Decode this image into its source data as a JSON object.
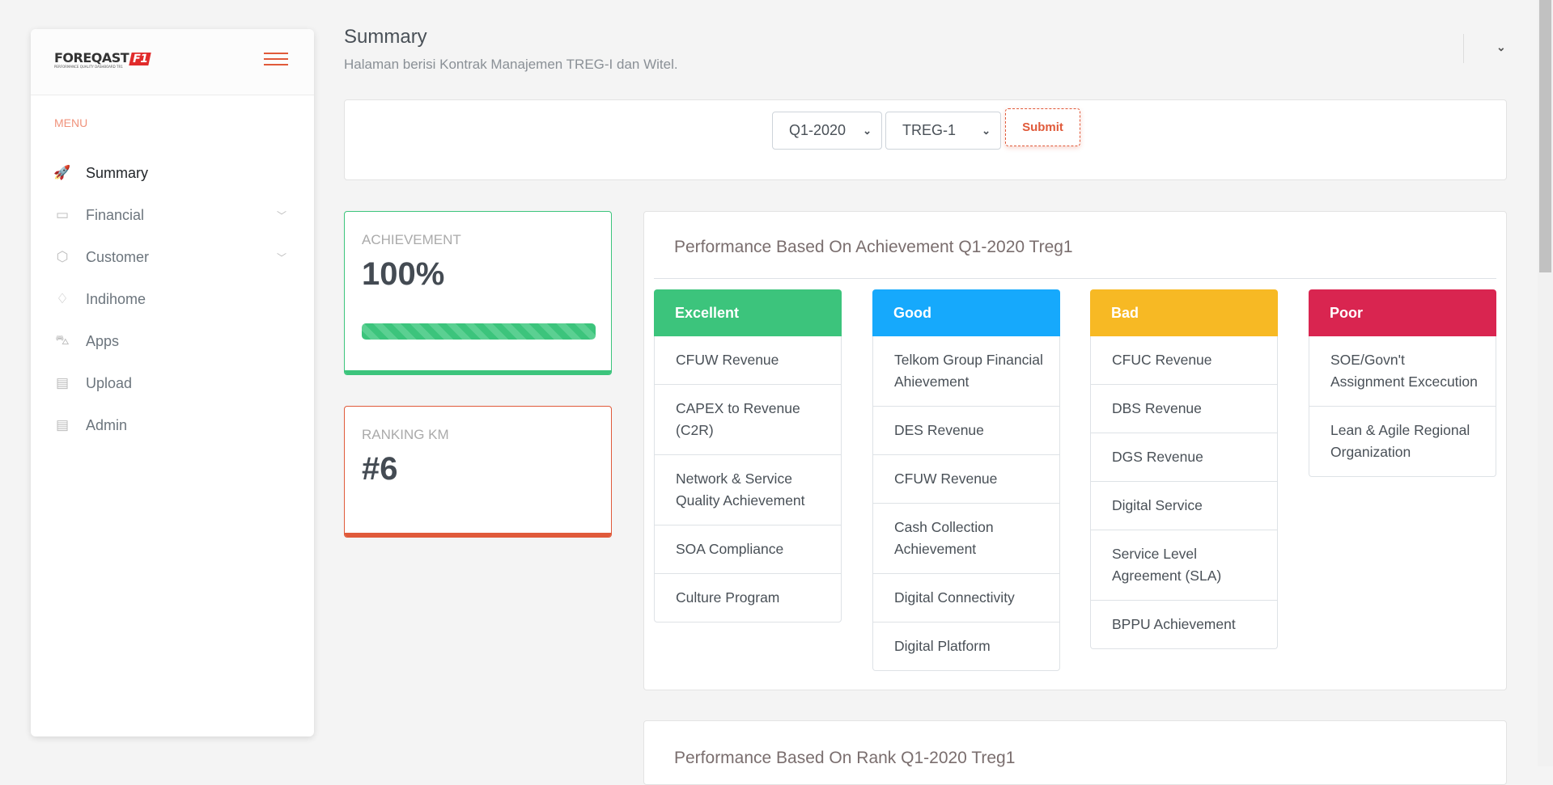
{
  "logo": {
    "text": "FOREQAST",
    "mark": "F1",
    "tagline": "PERFORMANCE QUALITY DASHBOARD TR1"
  },
  "sidebar": {
    "menu_label": "MENU",
    "items": [
      {
        "label": "Summary",
        "icon": "rocket-icon",
        "glyph": "🚀",
        "active": true
      },
      {
        "label": "Financial",
        "icon": "window-icon",
        "glyph": "▭",
        "chevron": "﹀"
      },
      {
        "label": "Customer",
        "icon": "box-icon",
        "glyph": "⬡",
        "chevron": "﹀"
      },
      {
        "label": "Indihome",
        "icon": "diamond-icon",
        "glyph": "♢"
      },
      {
        "label": "Apps",
        "icon": "car-icon",
        "glyph": "⛍"
      },
      {
        "label": "Upload",
        "icon": "monitor-icon",
        "glyph": "▤"
      },
      {
        "label": "Admin",
        "icon": "monitor-icon",
        "glyph": "▤"
      }
    ]
  },
  "header": {
    "title": "Summary",
    "subtitle": "Halaman berisi Kontrak Manajemen TREG-I dan Witel.",
    "chevron": "⌄"
  },
  "filter": {
    "period": "Q1-2020",
    "region": "TREG-1",
    "submit": "Submit",
    "chevron": "⌄"
  },
  "achievement": {
    "label": "ACHIEVEMENT",
    "value": "100%",
    "progress_percent": 100,
    "color": "#3cc47c"
  },
  "ranking": {
    "label": "RANKING KM",
    "value": "#6",
    "color": "#e05a3a"
  },
  "performance": {
    "title": "Performance Based On Achievement Q1-2020 Treg1",
    "columns": [
      {
        "title": "Excellent",
        "color": "#3cc47c",
        "items": [
          "CFUW Revenue",
          "CAPEX to Revenue (C2R)",
          "Network & Service Quality Achievement",
          "SOA Compliance",
          "Culture Program"
        ]
      },
      {
        "title": "Good",
        "color": "#16a9fc",
        "items": [
          "Telkom Group Financial Ahievement",
          "DES Revenue",
          "CFUW Revenue",
          "Cash Collection Achievement",
          "Digital Connectivity",
          "Digital Platform"
        ]
      },
      {
        "title": "Bad",
        "color": "#f7b924",
        "items": [
          "CFUC Revenue",
          "DBS Revenue",
          "DGS Revenue",
          "Digital Service",
          "Service Level Agreement (SLA)",
          "BPPU Achievement"
        ]
      },
      {
        "title": "Poor",
        "color": "#d92550",
        "items": [
          "SOE/Govn't Assignment Excecution",
          "Lean & Agile Regional Organization"
        ]
      }
    ]
  },
  "rank_section": {
    "title": "Performance Based On Rank Q1-2020 Treg1"
  }
}
